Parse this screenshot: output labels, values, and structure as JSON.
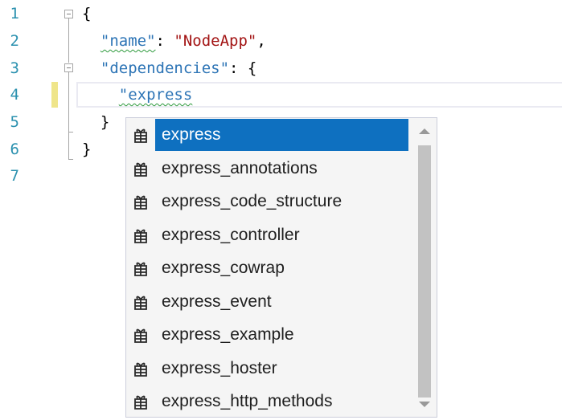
{
  "editor": {
    "line_numbers": [
      "1",
      "2",
      "3",
      "4",
      "5",
      "6",
      "7"
    ],
    "lines": [
      {
        "parts": [
          {
            "t": "{",
            "c": "punc"
          }
        ]
      },
      {
        "parts": [
          {
            "t": "  ",
            "c": "punc"
          },
          {
            "t": "\"name\"",
            "c": "key",
            "squiggle": true
          },
          {
            "t": ": ",
            "c": "punc"
          },
          {
            "t": "\"NodeApp\"",
            "c": "str"
          },
          {
            "t": ",",
            "c": "punc"
          }
        ]
      },
      {
        "parts": [
          {
            "t": "  ",
            "c": "punc"
          },
          {
            "t": "\"dependencies\"",
            "c": "key"
          },
          {
            "t": ": {",
            "c": "punc"
          }
        ]
      },
      {
        "parts": [
          {
            "t": "    ",
            "c": "punc"
          },
          {
            "t": "\"express",
            "c": "key",
            "squiggle": true
          }
        ]
      },
      {
        "parts": [
          {
            "t": "  }",
            "c": "punc"
          }
        ]
      },
      {
        "parts": [
          {
            "t": "}",
            "c": "punc"
          }
        ]
      },
      {
        "parts": []
      }
    ],
    "colors": {
      "line_number": "#2b91af",
      "json_key": "#2e75b6",
      "json_string": "#a31515",
      "squiggle": "#2e9a3c",
      "change_marker": "#efe58a"
    }
  },
  "completion": {
    "items": [
      {
        "label": "express",
        "icon": "package-icon"
      },
      {
        "label": "express_annotations",
        "icon": "package-icon"
      },
      {
        "label": "express_code_structure",
        "icon": "package-icon"
      },
      {
        "label": "express_controller",
        "icon": "package-icon"
      },
      {
        "label": "express_cowrap",
        "icon": "package-icon"
      },
      {
        "label": "express_event",
        "icon": "package-icon"
      },
      {
        "label": "express_example",
        "icon": "package-icon"
      },
      {
        "label": "express_hoster",
        "icon": "package-icon"
      },
      {
        "label": "express_http_methods",
        "icon": "package-icon"
      }
    ],
    "selected_index": 0,
    "selection_color": "#0e70c0",
    "scroll_up_icon": "scroll-up-arrow-icon",
    "scroll_down_icon": "scroll-down-arrow-icon"
  }
}
